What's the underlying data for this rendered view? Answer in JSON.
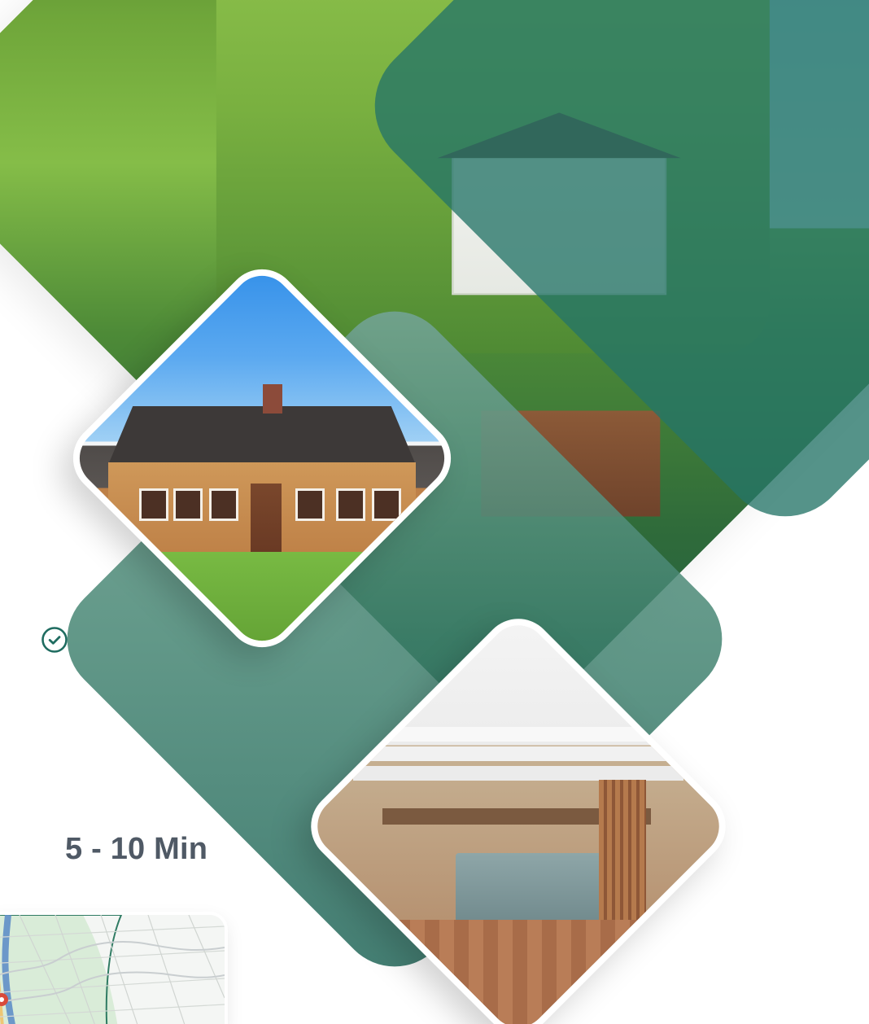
{
  "content": {
    "travel_time": "5 - 10 Min"
  },
  "icons": {
    "check": "check-circle-icon"
  },
  "colors": {
    "primary": "#1f6c60",
    "text": "#4f5965",
    "teal_overlay": "#257568"
  }
}
